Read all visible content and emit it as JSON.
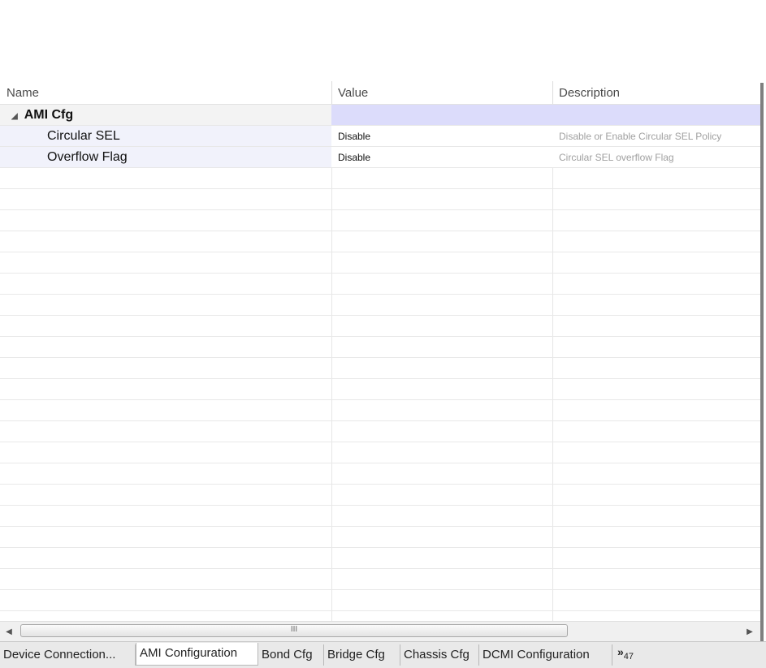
{
  "grid": {
    "columns": [
      {
        "label": "Name"
      },
      {
        "label": "Value"
      },
      {
        "label": "Description"
      }
    ],
    "group": {
      "label": "AMI Cfg",
      "icon": "expanded-triangle-icon"
    },
    "rows": [
      {
        "name": "Circular SEL",
        "value": "Disable",
        "description": "Disable or Enable Circular SEL Policy"
      },
      {
        "name": "Overflow Flag",
        "value": "Disable",
        "description": "Circular SEL overflow Flag"
      }
    ]
  },
  "scrollbar": {
    "left_icon": "scroll-left-arrow-icon",
    "right_icon": "scroll-right-arrow-icon",
    "grip": "III"
  },
  "tabs": {
    "items": [
      {
        "label": "Device Connection..."
      },
      {
        "label": "AMI Configuration",
        "active": true
      },
      {
        "label": "Bond Cfg"
      },
      {
        "label": "Bridge Cfg"
      },
      {
        "label": "Chassis Cfg"
      },
      {
        "label": "DCMI Configuration"
      }
    ],
    "more_label": "»",
    "more_count": "47"
  },
  "colors": {
    "group_value_bg": "#dcdcfb",
    "row_name_bg": "#f1f2fb",
    "desc_text": "#a0a0a0"
  }
}
